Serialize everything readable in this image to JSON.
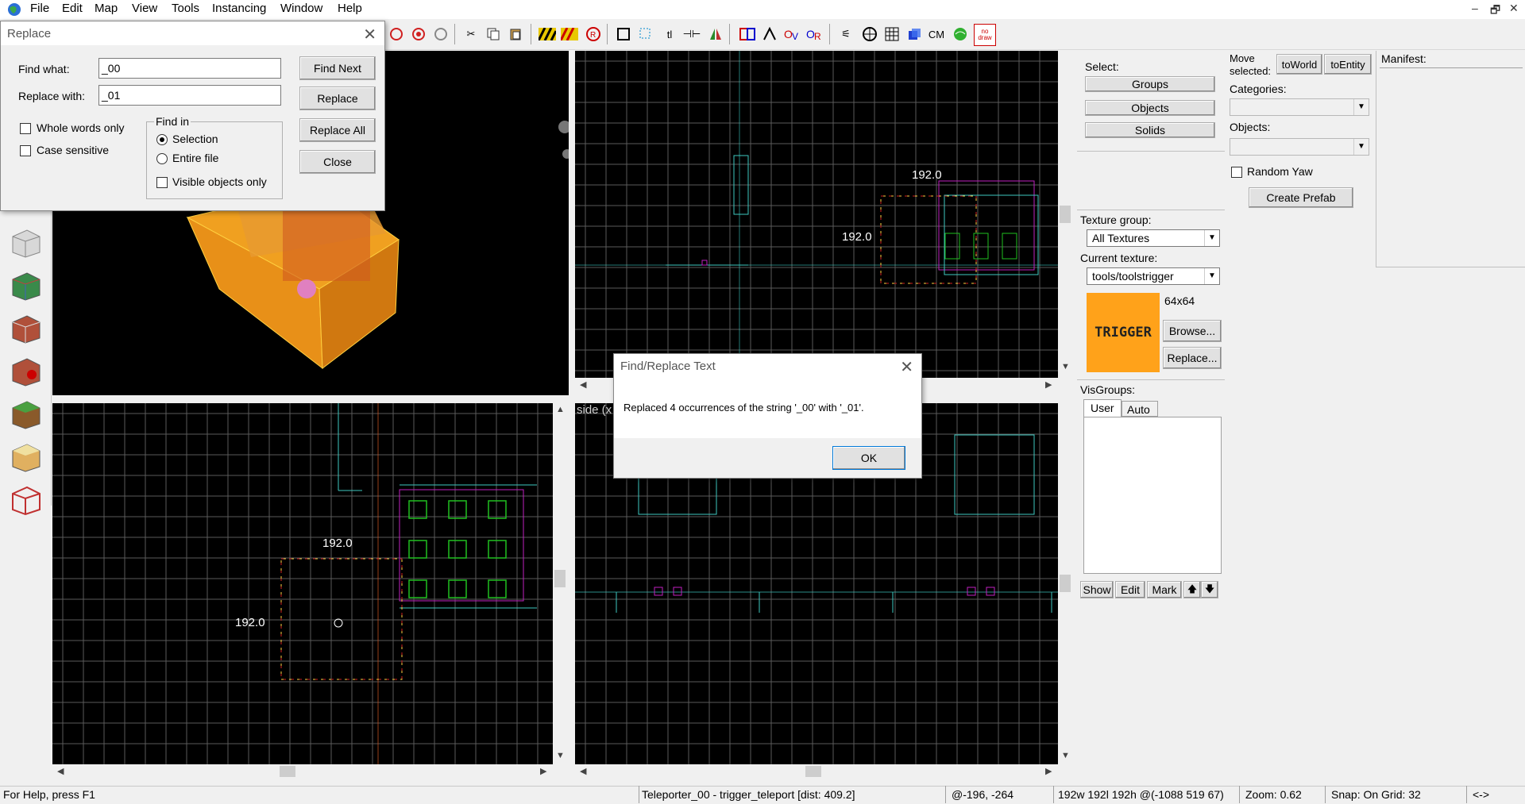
{
  "menu": [
    "File",
    "Edit",
    "Map",
    "View",
    "Tools",
    "Instancing",
    "Window",
    "Help"
  ],
  "window_controls": [
    "–",
    "🗗",
    "✕"
  ],
  "toolbar": {
    "cm_label": "CM",
    "nodraw_label": "no draw"
  },
  "replace_dialog": {
    "title": "Replace",
    "find_what_label": "Find what:",
    "find_what_value": "_00",
    "replace_with_label": "Replace with:",
    "replace_with_value": "_01",
    "whole_words_label": "Whole words only",
    "case_sensitive_label": "Case sensitive",
    "find_in_label": "Find in",
    "selection_label": "Selection",
    "entire_file_label": "Entire file",
    "visible_only_label": "Visible objects only",
    "find_next_label": "Find Next",
    "replace_label": "Replace",
    "replace_all_label": "Replace All",
    "close_label": "Close"
  },
  "message_dialog": {
    "title": "Find/Replace Text",
    "message": "Replaced 4 occurrences of the string '_00' with '_01'.",
    "ok_label": "OK"
  },
  "viewports": {
    "top_right_dim_top": "192.0",
    "top_right_dim_side": "192.0",
    "bottom_left_dim_top": "192.0",
    "bottom_left_dim_side": "192.0",
    "bottom_right_label": "side (x"
  },
  "select_panel": {
    "select_label": "Select:",
    "groups_label": "Groups",
    "objects_label": "Objects",
    "solids_label": "Solids"
  },
  "move_panel": {
    "move_selected_label_1": "Move",
    "move_selected_label_2": "selected:",
    "to_world_label": "toWorld",
    "to_entity_label": "toEntity",
    "categories_label": "Categories:",
    "objects_label": "Objects:",
    "random_yaw_label": "Random Yaw",
    "create_prefab_label": "Create Prefab"
  },
  "manifest_label": "Manifest:",
  "texture_panel": {
    "texture_group_label": "Texture group:",
    "texture_group_value": "All Textures",
    "current_texture_label": "Current texture:",
    "current_texture_value": "tools/toolstrigger",
    "texture_size": "64x64",
    "texture_preview_text": "TRIGGER",
    "browse_label": "Browse...",
    "replace_label": "Replace..."
  },
  "visgroups_panel": {
    "label": "VisGroups:",
    "tab_user": "User",
    "tab_auto": "Auto",
    "show_label": "Show",
    "edit_label": "Edit",
    "mark_label": "Mark",
    "up_label": "🡅",
    "down_label": "🡇"
  },
  "statusbar": {
    "help": "For Help, press F1",
    "selection": "Teleporter_00 - trigger_teleport   [dist: 409.2]",
    "coords": "@-196, -264",
    "size": "192w 192l 192h @(-1088 519 67)",
    "zoom": "Zoom: 0.62",
    "snap": "Snap: On Grid: 32",
    "arrows": "<->"
  },
  "colors": {
    "accent_orange": "#ffa21a",
    "grid": "#5a5a5a",
    "cyan": "#3ec8c0",
    "magenta": "#c020c0",
    "green": "#20c020"
  }
}
